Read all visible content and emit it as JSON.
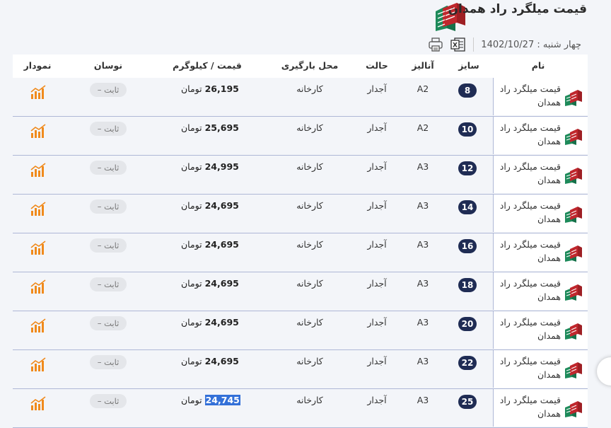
{
  "header": {
    "title": "قیمت میلگرد راد همدان",
    "date": "چهار شنبه : 1402/10/27",
    "excel_icon": "excel-icon",
    "print_icon": "print-icon"
  },
  "columns": {
    "name": "نام",
    "size": "سایز",
    "analysis": "آنالیز",
    "state": "حالت",
    "loading": "محل بارگیری",
    "price": "قیمت / کیلوگرم",
    "change": "نوسان",
    "chart": "نمودار"
  },
  "currency": "تومان",
  "rows": [
    {
      "name": "قیمت میلگرد راد همدان",
      "size": "8",
      "analysis": "A2",
      "state": "آجدار",
      "loading": "کارخانه",
      "price": "26,195",
      "change": "ثابت –"
    },
    {
      "name": "قیمت میلگرد راد همدان",
      "size": "10",
      "analysis": "A2",
      "state": "آجدار",
      "loading": "کارخانه",
      "price": "25,695",
      "change": "ثابت –"
    },
    {
      "name": "قیمت میلگرد راد همدان",
      "size": "12",
      "analysis": "A3",
      "state": "آجدار",
      "loading": "کارخانه",
      "price": "24,995",
      "change": "ثابت –"
    },
    {
      "name": "قیمت میلگرد راد همدان",
      "size": "14",
      "analysis": "A3",
      "state": "آجدار",
      "loading": "کارخانه",
      "price": "24,695",
      "change": "ثابت –"
    },
    {
      "name": "قیمت میلگرد راد همدان",
      "size": "16",
      "analysis": "A3",
      "state": "آجدار",
      "loading": "کارخانه",
      "price": "24,695",
      "change": "ثابت –"
    },
    {
      "name": "قیمت میلگرد راد همدان",
      "size": "18",
      "analysis": "A3",
      "state": "آجدار",
      "loading": "کارخانه",
      "price": "24,695",
      "change": "ثابت –"
    },
    {
      "name": "قیمت میلگرد راد همدان",
      "size": "20",
      "analysis": "A3",
      "state": "آجدار",
      "loading": "کارخانه",
      "price": "24,695",
      "change": "ثابت –"
    },
    {
      "name": "قیمت میلگرد راد همدان",
      "size": "22",
      "analysis": "A3",
      "state": "آجدار",
      "loading": "کارخانه",
      "price": "24,695",
      "change": "ثابت –"
    },
    {
      "name": "قیمت میلگرد راد همدان",
      "size": "25",
      "analysis": "A3",
      "state": "آجدار",
      "loading": "کارخانه",
      "price": "24,745",
      "change": "ثابت –",
      "highlight": true
    }
  ],
  "colors": {
    "badge": "#1f2c54",
    "accent_red": "#c0272d",
    "accent_green": "#1d8a5a",
    "chart_orange": "#f08a1c",
    "selection": "#3370d8"
  }
}
